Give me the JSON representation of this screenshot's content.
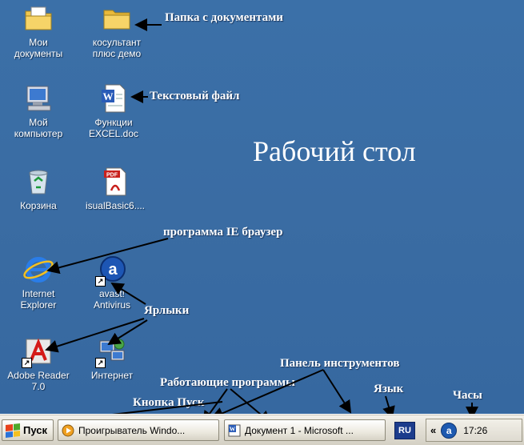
{
  "desktop": {
    "title": "Рабочий стол",
    "icons": [
      {
        "label": "Мои\nдокументы",
        "icon": "my-documents-icon"
      },
      {
        "label": "косультант\nплюс демо",
        "icon": "folder-icon"
      },
      {
        "label": "Мой\nкомпьютер",
        "icon": "my-computer-icon"
      },
      {
        "label": "Функции\nEXCEL.doc",
        "icon": "word-document-icon"
      },
      {
        "label": "Корзина",
        "icon": "recycle-bin-icon"
      },
      {
        "label": "isualBasic6....",
        "icon": "pdf-document-icon"
      },
      {
        "label": "Internet\nExplorer",
        "icon": "internet-explorer-icon"
      },
      {
        "label": "avast!\nAntivirus",
        "icon": "avast-icon"
      },
      {
        "label": "Adobe Reader\n7.0",
        "icon": "adobe-reader-icon"
      },
      {
        "label": "Интернет",
        "icon": "network-icon"
      }
    ]
  },
  "annotations": {
    "folder": "Папка с документами",
    "text_file": "Текстовый файл",
    "ie_browser": "программа  IE браузер",
    "shortcuts": "Ярлыки",
    "toolbar": "Панель инструментов",
    "language": "Язык",
    "clock": "Часы",
    "running_programs": "Работающие программы",
    "start_button": "Кнопка Пуск"
  },
  "taskbar": {
    "start_label": "Пуск",
    "tasks": [
      {
        "label": "Проигрыватель Windo...",
        "icon": "media-player-icon"
      },
      {
        "label": "Документ 1 - Microsoft ...",
        "icon": "word-icon"
      }
    ],
    "language": "RU",
    "tray_chevron": "«",
    "tray_avast": "a",
    "clock": "17:26"
  },
  "colors": {
    "desktop": "#3a6ea5",
    "taskbar": "#ece9df",
    "text": "#ffffff"
  }
}
